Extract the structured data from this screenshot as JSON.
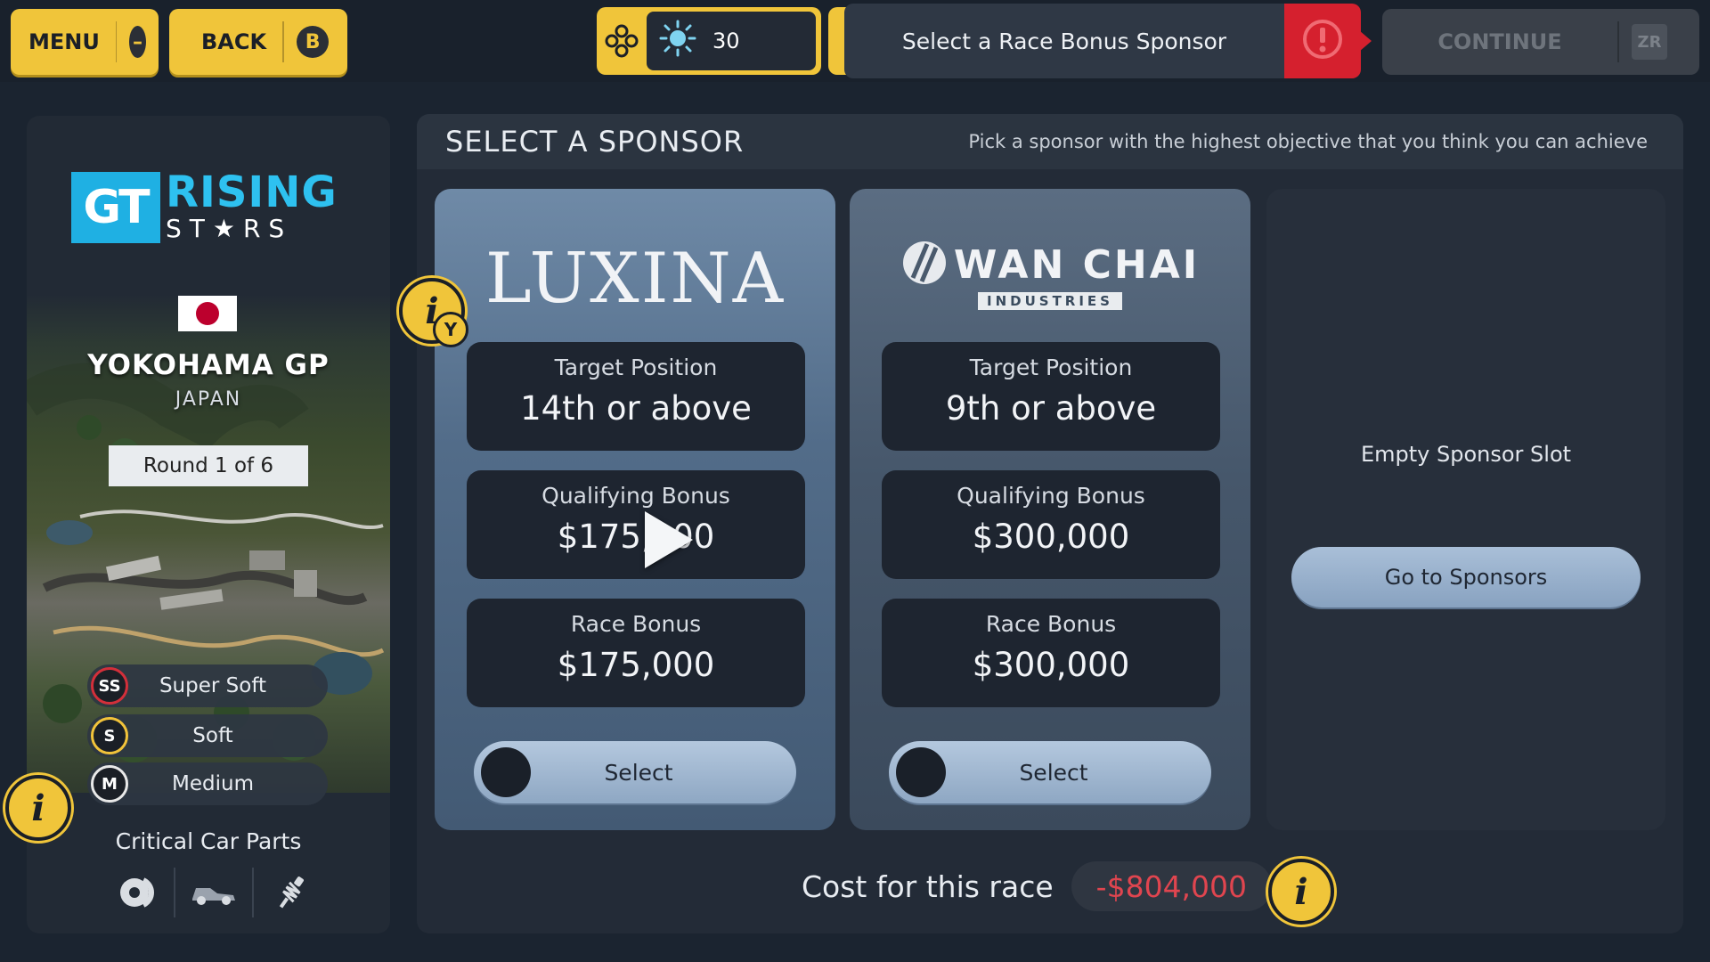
{
  "topbar": {
    "menu_label": "MENU",
    "menu_badge": "–",
    "back_label": "BACK",
    "back_badge": "B",
    "counter_value": "30",
    "prompt_text": "Select a Race Bonus Sponsor",
    "continue_label": "CONTINUE",
    "continue_badge": "ZR",
    "icons": [
      "gamepad-icon",
      "gear-sun-icon",
      "alert-icon"
    ]
  },
  "event": {
    "logo_main": "GT",
    "logo_line1": "RISING",
    "logo_line2": "ST★RS",
    "flag": "japan-flag",
    "name": "YOKOHAMA GP",
    "country": "JAPAN",
    "round": "Round 1 of 6",
    "tyres": [
      {
        "code": "SS",
        "name": "Super Soft",
        "color": "#d32f3a"
      },
      {
        "code": "S",
        "name": "Soft",
        "color": "#f2c33a"
      },
      {
        "code": "M",
        "name": "Medium",
        "color": "#e8e8e8"
      }
    ],
    "parts_title": "Critical Car Parts",
    "parts_icons": [
      "brake-icon",
      "car-body-icon",
      "suspension-icon"
    ]
  },
  "panel": {
    "title": "SELECT A SPONSOR",
    "hint": "Pick a sponsor with the highest objective that you think you can achieve"
  },
  "sponsors": [
    {
      "brand": "LUXINA",
      "target_label": "Target Position",
      "target_value": "14th or above",
      "qual_label": "Qualifying Bonus",
      "qual_value": "$175,000",
      "race_label": "Race Bonus",
      "race_value": "$175,000",
      "select_label": "Select"
    },
    {
      "brand": "WAN CHAI",
      "brand_sub": "INDUSTRIES",
      "target_label": "Target Position",
      "target_value": "9th or above",
      "qual_label": "Qualifying Bonus",
      "qual_value": "$300,000",
      "race_label": "Race Bonus",
      "race_value": "$300,000",
      "select_label": "Select"
    }
  ],
  "empty_slot": {
    "label": "Empty Sponsor Slot",
    "button": "Go to Sponsors"
  },
  "cost": {
    "label": "Cost for this race",
    "value": "-$804,000"
  },
  "info": {
    "icon_glyph": "i",
    "y_badge": "Y"
  },
  "colors": {
    "accent_yellow": "#f0c53a",
    "alert_red": "#d5202e",
    "cost_red": "#e0454f",
    "brand_cyan": "#1fb0e3"
  }
}
